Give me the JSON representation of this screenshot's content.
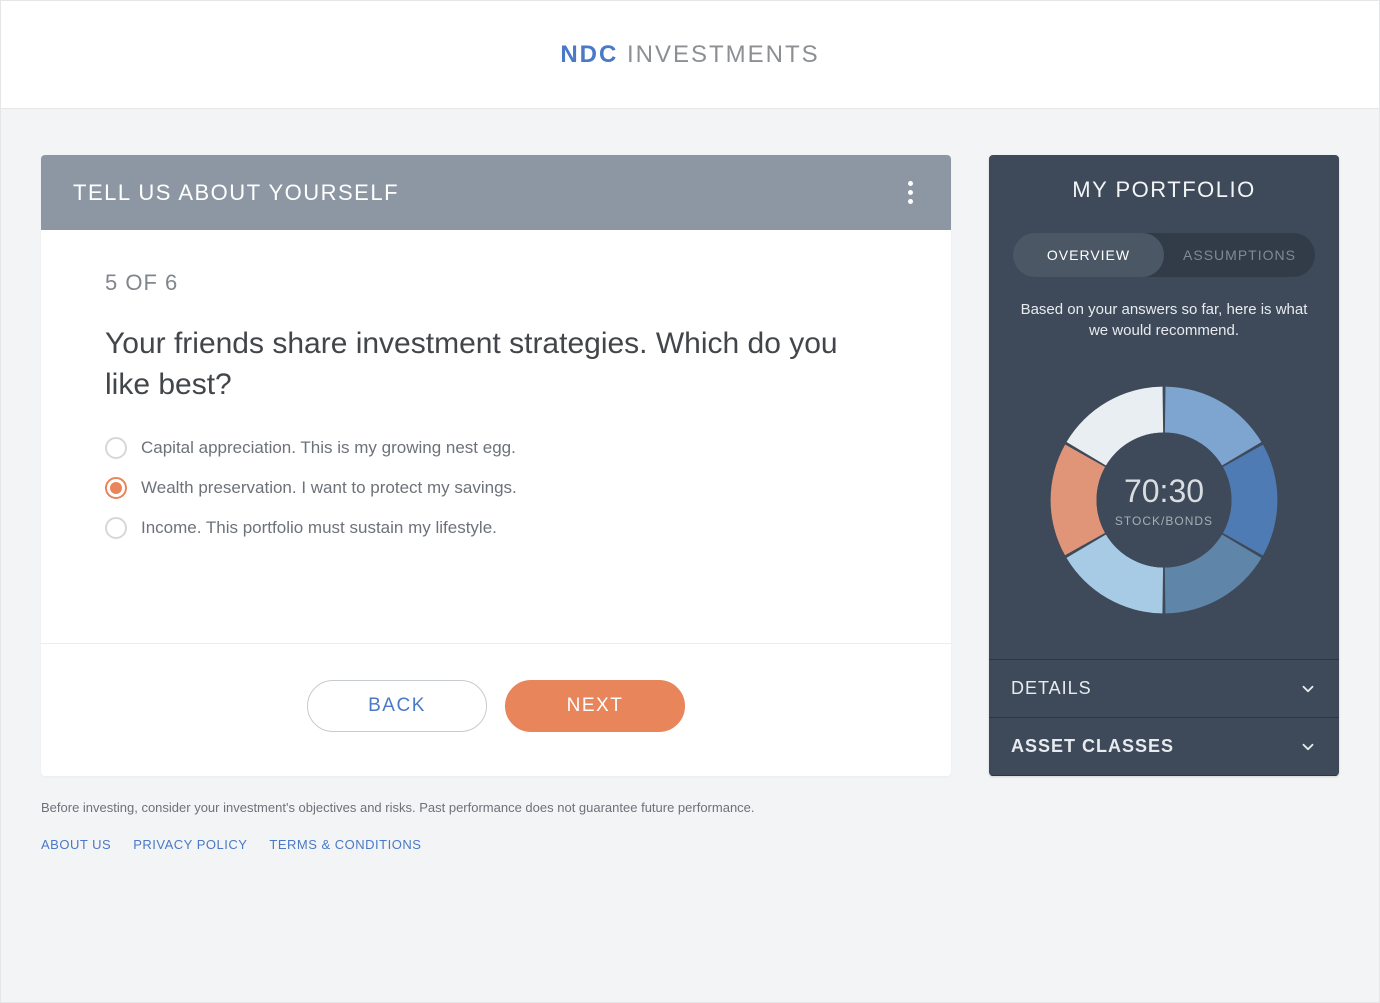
{
  "brand": {
    "bold": "NDC",
    "rest": " INVESTMENTS"
  },
  "card": {
    "header_title": "TELL US ABOUT YOURSELF",
    "step_label": "5 OF 6",
    "question": "Your friends share investment strategies. Which do you like best?",
    "options": [
      {
        "label": "Capital appreciation. This is my growing nest egg.",
        "selected": false
      },
      {
        "label": "Wealth preservation. I want to protect my savings.",
        "selected": true
      },
      {
        "label": "Income. This portfolio must sustain my lifestyle.",
        "selected": false
      }
    ],
    "back_label": "BACK",
    "next_label": "NEXT"
  },
  "sidebar": {
    "title": "MY PORTFOLIO",
    "tabs": [
      {
        "label": "OVERVIEW",
        "active": true
      },
      {
        "label": "ASSUMPTIONS",
        "active": false
      }
    ],
    "subtext": "Based on your answers so far, here is what we would recommend.",
    "ratio_value": "70:30",
    "ratio_label": "STOCK/BONDS",
    "accordion": [
      {
        "label": "DETAILS",
        "strong": false
      },
      {
        "label": "ASSET CLASSES",
        "strong": true
      }
    ]
  },
  "chart_data": {
    "type": "pie",
    "title": "Recommended Portfolio Allocation",
    "annotation_center": "70:30 STOCK/BONDS",
    "note": "Donut segments appear roughly equal in angular size; colors only are shown (no per-segment labels). Estimated equal 1/6 slices.",
    "segments": [
      {
        "color": "#e9eef3",
        "value_fraction": 0.1667
      },
      {
        "color": "#7ea5cf",
        "value_fraction": 0.1667
      },
      {
        "color": "#4f7bb5",
        "value_fraction": 0.1667
      },
      {
        "color": "#5f86a9",
        "value_fraction": 0.1667
      },
      {
        "color": "#a8cbe5",
        "value_fraction": 0.1667
      },
      {
        "color": "#e19578",
        "value_fraction": 0.1667
      }
    ]
  },
  "footer": {
    "disclaimer": "Before investing, consider your investment's objectives and risks. Past performance does not guarantee future performance.",
    "links": [
      {
        "label": "ABOUT US"
      },
      {
        "label": "PRIVACY POLICY"
      },
      {
        "label": "TERMS & CONDITIONS"
      }
    ]
  }
}
